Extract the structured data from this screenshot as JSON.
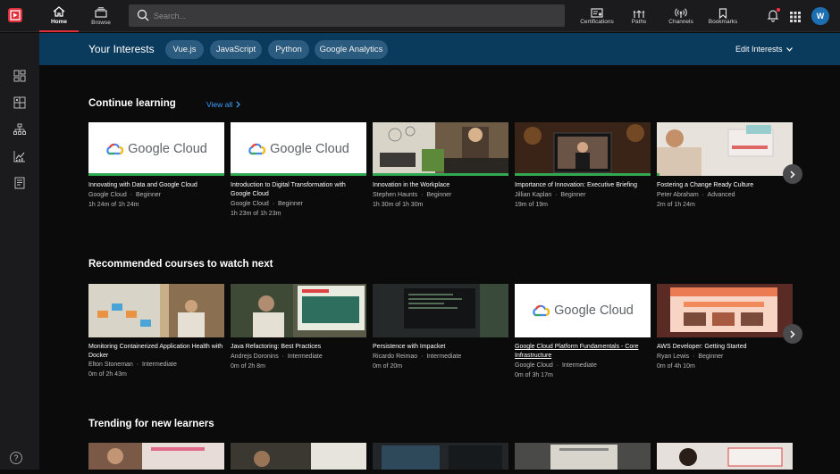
{
  "header": {
    "nav": [
      {
        "label": "Home",
        "icon": "home-icon"
      },
      {
        "label": "Browse",
        "icon": "browse-icon"
      }
    ],
    "search_placeholder": "Search...",
    "right_nav": [
      {
        "label": "Certifications",
        "icon": "certifications-icon"
      },
      {
        "label": "Paths",
        "icon": "paths-icon"
      },
      {
        "label": "Channels",
        "icon": "channels-icon"
      },
      {
        "label": "Bookmarks",
        "icon": "bookmark-icon"
      }
    ],
    "avatar": "W"
  },
  "interests": {
    "title": "Your Interests",
    "chips": [
      "Vue.js",
      "JavaScript",
      "Python",
      "Google Analytics"
    ],
    "edit_label": "Edit Interests"
  },
  "colors": {
    "accent": "#e0303c",
    "link": "#3fa0ff",
    "banner": "#0a3a5c",
    "google_green": "#33a853"
  },
  "sections": [
    {
      "title": "Continue learning",
      "view_all": "View all",
      "cards": [
        {
          "title": "Innovating with Data and Google Cloud",
          "author": "Google Cloud",
          "level": "Beginner",
          "progress": "1h 24m of 1h 24m",
          "thumb": "google-cloud-logo",
          "completion": 1.0
        },
        {
          "title": "Introduction to Digital Transformation with Google Cloud",
          "author": "Google Cloud",
          "level": "Beginner",
          "progress": "1h 23m of 1h 23m",
          "thumb": "google-cloud-logo",
          "completion": 1.0
        },
        {
          "title": "Innovation in the Workplace",
          "author": "Stephen Haunts",
          "level": "Beginner",
          "progress": "1h 30m of 1h 30m",
          "thumb": "photo-person-laptop",
          "completion": 1.0
        },
        {
          "title": "Importance of Innovation: Executive Briefing",
          "author": "Jillian Kaplan",
          "level": "Beginner",
          "progress": "19m of 19m",
          "thumb": "photo-presenter",
          "completion": 1.0
        },
        {
          "title": "Fostering a Change Ready Culture",
          "author": "Peter Abraham",
          "level": "Advanced",
          "progress": "2m of 1h 24m",
          "thumb": "photo-woman-charts",
          "completion": 0.02
        }
      ]
    },
    {
      "title": "Recommended courses to watch next",
      "cards": [
        {
          "title": "Monitoring Containerized Application Health with Docker",
          "author": "Elton Stoneman",
          "level": "Intermediate",
          "progress": "0m of 2h 43m",
          "thumb": "photo-containers"
        },
        {
          "title": "Java Refactoring: Best Practices",
          "author": "Andrejs Doronins",
          "level": "Intermediate",
          "progress": "0m of 2h 8m",
          "thumb": "photo-coder"
        },
        {
          "title": "Persistence with Impacket",
          "author": "Ricardo Reimao",
          "level": "Intermediate",
          "progress": "0m of 20m",
          "thumb": "photo-terminal"
        },
        {
          "title": "Google Cloud Platform Fundamentals - Core Infrastructure",
          "author": "Google Cloud",
          "level": "Intermediate",
          "progress": "0m of 3h 17m",
          "thumb": "google-cloud-logo"
        },
        {
          "title": "AWS Developer: Getting Started",
          "author": "Ryan Lewis",
          "level": "Beginner",
          "progress": "0m of 4h 10m",
          "thumb": "photo-website"
        }
      ]
    },
    {
      "title": "Trending for new learners"
    }
  ],
  "gc_brand": "Google Cloud"
}
